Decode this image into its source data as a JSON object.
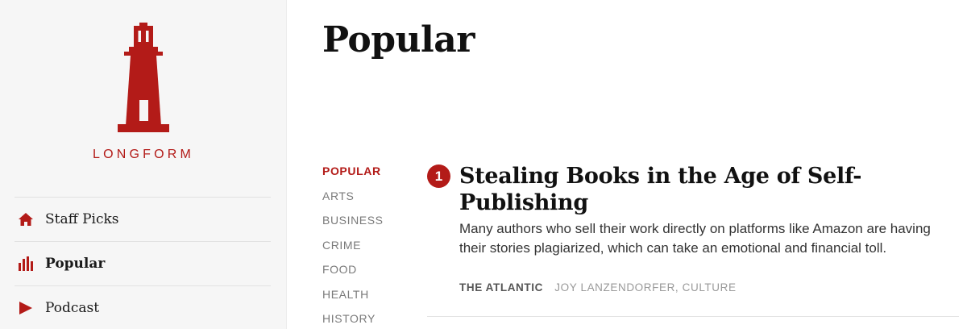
{
  "brand": {
    "name": "LONGFORM",
    "accent_color": "#b31b18"
  },
  "sidebar": {
    "nav": [
      {
        "label": "Staff Picks",
        "icon": "home-icon"
      },
      {
        "label": "Popular",
        "icon": "bar-chart-icon",
        "active": true
      },
      {
        "label": "Podcast",
        "icon": "play-icon"
      }
    ]
  },
  "main": {
    "title": "Popular",
    "categories": [
      {
        "label": "POPULAR",
        "active": true
      },
      {
        "label": "ARTS"
      },
      {
        "label": "BUSINESS"
      },
      {
        "label": "CRIME"
      },
      {
        "label": "FOOD"
      },
      {
        "label": "HEALTH"
      },
      {
        "label": "HISTORY"
      }
    ],
    "articles": [
      {
        "rank": "1",
        "title": "Stealing Books in the Age of Self-Publishing",
        "description": "Many authors who sell their work directly on platforms like Amazon are having their stories plagiarized, which can take an emotional and financial toll.",
        "publication": "THE ATLANTIC",
        "byline": "JOY LANZENDORFER, CULTURE"
      }
    ]
  }
}
